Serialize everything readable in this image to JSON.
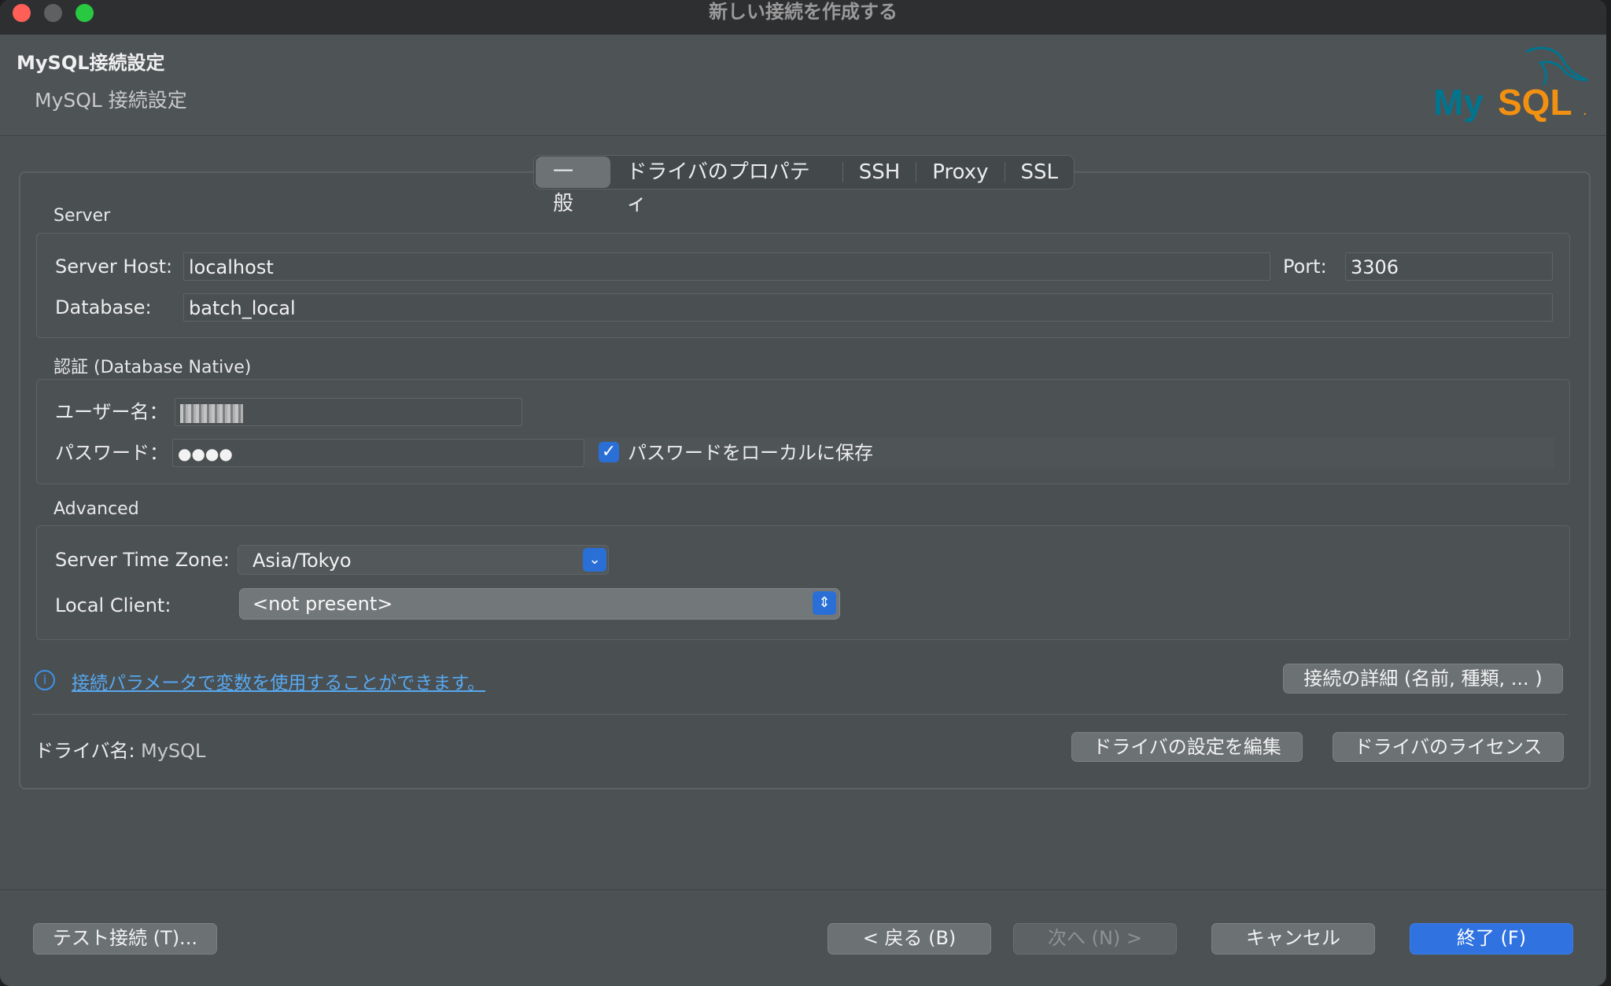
{
  "window": {
    "title": "新しい接続を作成する"
  },
  "header": {
    "title": "MySQL接続設定",
    "subtitle": "MySQL 接続設定",
    "logo_text": "MySQL."
  },
  "tabs": [
    {
      "label": "一般",
      "active": true
    },
    {
      "label": "ドライバのプロパティ",
      "active": false
    },
    {
      "label": "SSH",
      "active": false
    },
    {
      "label": "Proxy",
      "active": false
    },
    {
      "label": "SSL",
      "active": false
    }
  ],
  "server": {
    "section_label": "Server",
    "host_label": "Server Host:",
    "host_value": "localhost",
    "port_label": "Port:",
    "port_value": "3306",
    "database_label": "Database:",
    "database_value": "batch_local"
  },
  "auth": {
    "section_label": "認証 (Database Native)",
    "username_label": "ユーザー名：",
    "password_label": "パスワード：",
    "password_value": "●●●●",
    "save_password_label": "パスワードをローカルに保存",
    "save_password_checked": true
  },
  "advanced": {
    "section_label": "Advanced",
    "timezone_label": "Server Time Zone:",
    "timezone_value": "Asia/Tokyo",
    "local_client_label": "Local Client:",
    "local_client_value": "<not present>"
  },
  "info": {
    "link_text": "接続パラメータで変数を使用することができます。",
    "details_button": "接続の詳細 (名前, 種類, ... )"
  },
  "driver": {
    "name_label": "ドライバ名:",
    "name_value": "MySQL",
    "edit_button": "ドライバの設定を編集",
    "license_button": "ドライバのライセンス"
  },
  "footer": {
    "test_button": "テスト接続 (T)...",
    "back_button": "< 戻る (B)",
    "next_button": "次へ (N) >",
    "cancel_button": "キャンセル",
    "finish_button": "終了 (F)"
  },
  "colors": {
    "accent": "#2f72e0",
    "link": "#57a9f2",
    "logo_teal": "#00758f",
    "logo_orange": "#f29111"
  }
}
